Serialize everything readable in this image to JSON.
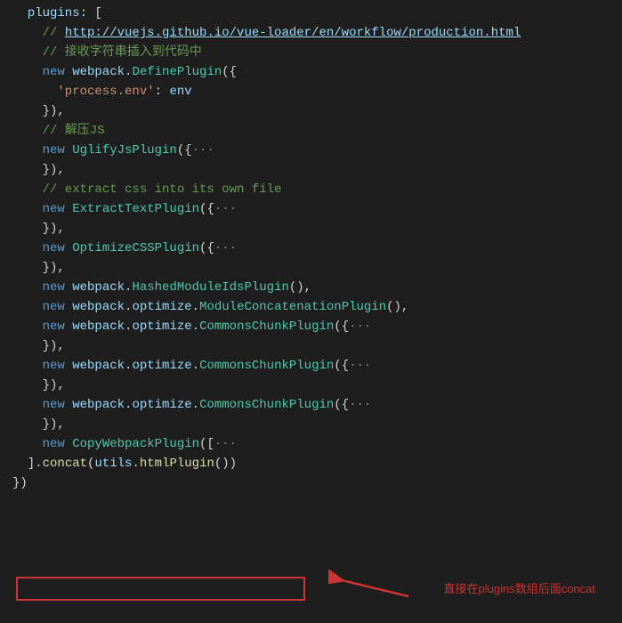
{
  "code": {
    "line1_p1": "  plugins",
    "line1_p2": ": [",
    "line2_c": "    // ",
    "line2_link": "http://vuejs.github.io/vue-loader/en/workflow/production.html",
    "line3": "    // 接收字符串插入到代码中",
    "line4_new": "    new",
    "line4_webpack": " webpack",
    "line4_dot": ".",
    "line4_class": "DefinePlugin",
    "line4_paren": "({",
    "line5_key": "      'process.env'",
    "line5_colon": ": ",
    "line5_val": "env",
    "line6": "    }),",
    "line7": "    // 解压JS",
    "line8_new": "    new",
    "line8_class": " UglifyJsPlugin",
    "line8_paren": "({",
    "line8_dots": "···",
    "line9": "    }),",
    "line10": "    // extract css into its own file",
    "line11_new": "    new",
    "line11_class": " ExtractTextPlugin",
    "line11_paren": "({",
    "line11_dots": "···",
    "line12": "    }),",
    "line13": "",
    "line14_new": "    new",
    "line14_class": " OptimizeCSSPlugin",
    "line14_paren": "({",
    "line14_dots": "···",
    "line15": "    }),",
    "line16_new": "    new",
    "line16_webpack": " webpack",
    "line16_dot": ".",
    "line16_class": "HashedModuleIdsPlugin",
    "line16_paren": "(),",
    "line17_new": "    new",
    "line17_webpack": " webpack",
    "line17_dot1": ".",
    "line17_opt": "optimize",
    "line17_dot2": ".",
    "line17_class": "ModuleConcatenationPlugin",
    "line17_paren": "(),",
    "line18": "",
    "line19_new": "    new",
    "line19_webpack": " webpack",
    "line19_dot1": ".",
    "line19_opt": "optimize",
    "line19_dot2": ".",
    "line19_class": "CommonsChunkPlugin",
    "line19_paren": "({",
    "line19_dots": "···",
    "line20": "    }),",
    "line21": "",
    "line22_new": "    new",
    "line22_webpack": " webpack",
    "line22_dot1": ".",
    "line22_opt": "optimize",
    "line22_dot2": ".",
    "line22_class": "CommonsChunkPlugin",
    "line22_paren": "({",
    "line22_dots": "···",
    "line23": "    }),",
    "line24": "",
    "line25_new": "    new",
    "line25_webpack": " webpack",
    "line25_dot1": ".",
    "line25_opt": "optimize",
    "line25_dot2": ".",
    "line25_class": "CommonsChunkPlugin",
    "line25_paren": "({",
    "line25_dots": "···",
    "line26": "    }),",
    "line27": "",
    "line28_new": "    new",
    "line28_class": " CopyWebpackPlugin",
    "line28_paren": "([",
    "line28_dots": "···",
    "line29_bracket": "  ].",
    "line29_concat": "concat",
    "line29_paren1": "(",
    "line29_utils": "utils",
    "line29_dot": ".",
    "line29_html": "htmlPlugin",
    "line29_paren2": "())",
    "line30": "})"
  },
  "annotation": "直接在plugins数组后面concat"
}
